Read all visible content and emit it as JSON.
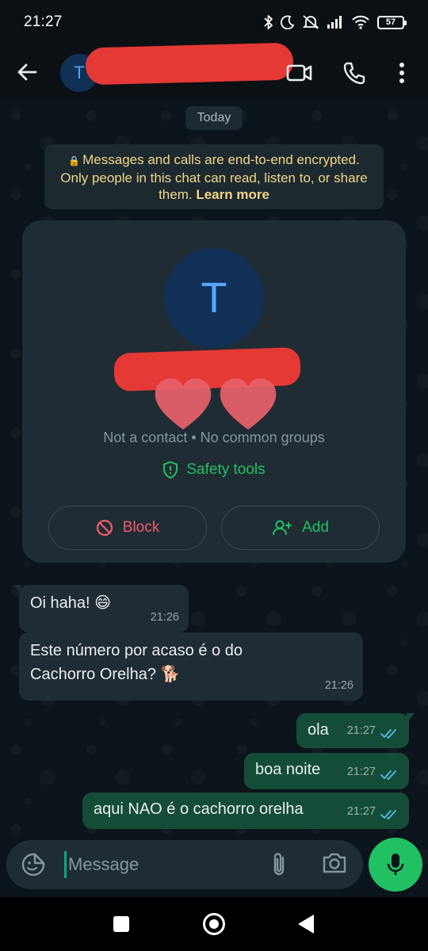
{
  "status_bar": {
    "time": "21:27",
    "battery": "57",
    "icons": [
      "bluetooth-icon",
      "do-not-disturb-moon-icon",
      "muted-bell-icon",
      "signal-icon",
      "wifi-icon",
      "battery-icon"
    ]
  },
  "header": {
    "avatar_letter": "T",
    "contact_name": "",
    "actions": [
      "video-call-icon",
      "voice-call-icon",
      "more-options-icon"
    ]
  },
  "chat": {
    "date_chip": "Today",
    "encryption": {
      "text": "Messages and calls are end-to-end encrypted. Only people in this chat can read, listen to, or share them.",
      "link": "Learn more"
    },
    "profile_card": {
      "avatar_letter": "T",
      "name": "",
      "meta": "Not a contact • No common groups",
      "safety_tools": "Safety tools",
      "block_label": "Block",
      "add_label": "Add"
    },
    "messages": [
      {
        "direction": "in",
        "text": "Oi haha! 😄",
        "time": "21:26"
      },
      {
        "direction": "in",
        "text": "Este número por acaso é o do Cachorro Orelha? 🐕",
        "time": "21:26"
      },
      {
        "direction": "out",
        "text": "ola",
        "time": "21:27",
        "status": "read"
      },
      {
        "direction": "out",
        "text": "boa noite",
        "time": "21:27",
        "status": "read"
      },
      {
        "direction": "out",
        "text": "aqui NAO é o cachorro orelha",
        "time": "21:27",
        "status": "read"
      }
    ]
  },
  "composer": {
    "placeholder": "Message",
    "value": ""
  },
  "colors": {
    "accent_green": "#21c063",
    "outgoing_bubble": "#144d37",
    "incoming_bubble": "#202c33",
    "block_red": "#f15c6d",
    "read_tick_blue": "#53bdeb",
    "redaction_red": "#e53935"
  }
}
